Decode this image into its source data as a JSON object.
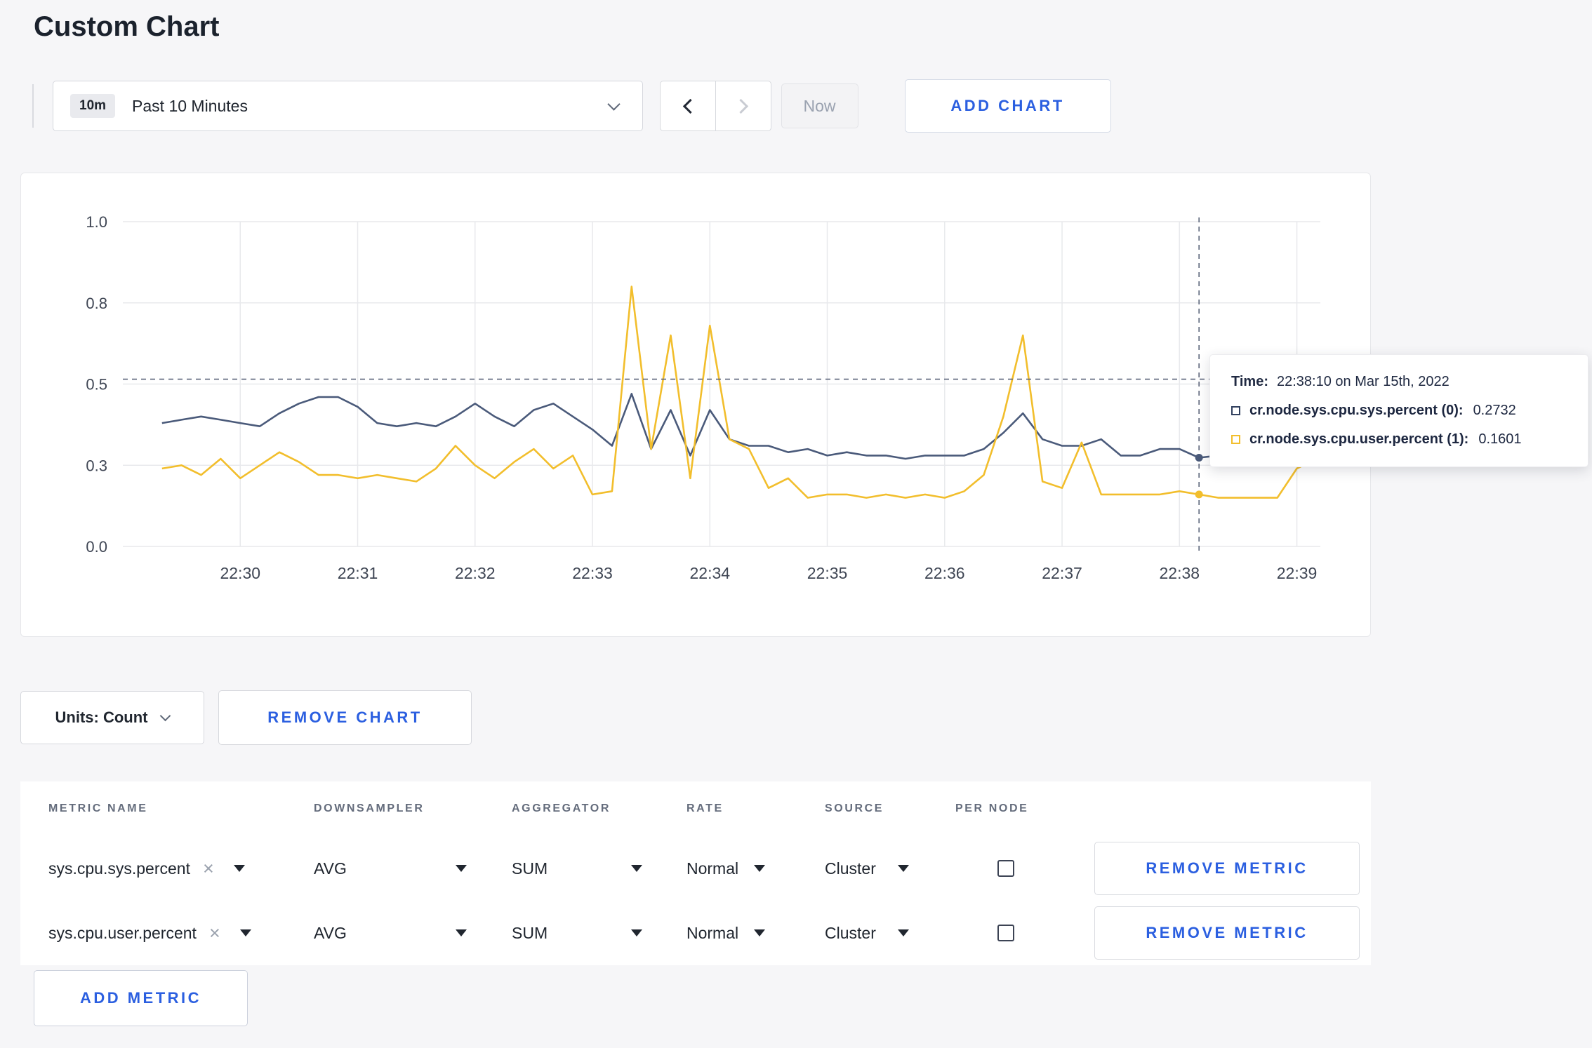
{
  "page": {
    "title": "Custom Chart"
  },
  "icons": {
    "clear": "×"
  },
  "colors": {
    "accent_blue": "#2b5fe0",
    "series_sys": "#4a5a7a",
    "series_user": "#f2be2c"
  },
  "toolbar": {
    "time_range_badge": "10m",
    "time_range_label": "Past 10 Minutes",
    "now_label": "Now",
    "add_chart_label": "ADD CHART"
  },
  "tooltip": {
    "time_label": "Time:",
    "time_value": "22:38:10 on Mar 15th, 2022",
    "rows": [
      {
        "name": "cr.node.sys.cpu.sys.percent (0):",
        "value": "0.2732",
        "color": "#32415f"
      },
      {
        "name": "cr.node.sys.cpu.user.percent (1):",
        "value": "0.1601",
        "color": "#f2be2c"
      }
    ]
  },
  "chart_data": {
    "type": "line",
    "title": "",
    "xlabel": "",
    "ylabel": "",
    "grid": true,
    "y_domain": [
      0,
      1
    ],
    "y_ticks": [
      {
        "value": 0,
        "label": "0.0"
      },
      {
        "value": 0.25,
        "label": "0.3"
      },
      {
        "value": 0.5,
        "label": "0.5"
      },
      {
        "value": 0.75,
        "label": "0.8"
      },
      {
        "value": 1,
        "label": "1.0"
      }
    ],
    "x_domain_seconds": [
      0,
      612
    ],
    "x_ticks": [
      {
        "second": 60,
        "label": "22:30"
      },
      {
        "second": 120,
        "label": "22:31"
      },
      {
        "second": 180,
        "label": "22:32"
      },
      {
        "second": 240,
        "label": "22:33"
      },
      {
        "second": 300,
        "label": "22:34"
      },
      {
        "second": 360,
        "label": "22:35"
      },
      {
        "second": 420,
        "label": "22:36"
      },
      {
        "second": 480,
        "label": "22:37"
      },
      {
        "second": 540,
        "label": "22:38"
      },
      {
        "second": 600,
        "label": "22:39"
      }
    ],
    "data_start_second": 20,
    "data_interval_seconds": 10,
    "series": [
      {
        "name": "cr.node.sys.cpu.sys.percent",
        "color": "#4a5a7a",
        "values": [
          0.38,
          0.39,
          0.4,
          0.39,
          0.38,
          0.37,
          0.41,
          0.44,
          0.46,
          0.46,
          0.43,
          0.38,
          0.37,
          0.38,
          0.37,
          0.4,
          0.44,
          0.4,
          0.37,
          0.42,
          0.44,
          0.4,
          0.36,
          0.31,
          0.47,
          0.3,
          0.42,
          0.28,
          0.42,
          0.33,
          0.31,
          0.31,
          0.29,
          0.3,
          0.28,
          0.29,
          0.28,
          0.28,
          0.27,
          0.28,
          0.28,
          0.28,
          0.3,
          0.35,
          0.41,
          0.33,
          0.31,
          0.31,
          0.33,
          0.28,
          0.28,
          0.3,
          0.3,
          0.2732,
          0.28,
          0.3,
          0.33,
          0.3,
          0.3,
          0.31
        ]
      },
      {
        "name": "cr.node.sys.cpu.user.percent",
        "color": "#f2be2c",
        "values": [
          0.24,
          0.25,
          0.22,
          0.27,
          0.21,
          0.25,
          0.29,
          0.26,
          0.22,
          0.22,
          0.21,
          0.22,
          0.21,
          0.2,
          0.24,
          0.31,
          0.25,
          0.21,
          0.26,
          0.3,
          0.24,
          0.28,
          0.16,
          0.17,
          0.8,
          0.3,
          0.65,
          0.21,
          0.68,
          0.33,
          0.3,
          0.18,
          0.21,
          0.15,
          0.16,
          0.16,
          0.15,
          0.16,
          0.15,
          0.16,
          0.15,
          0.17,
          0.22,
          0.4,
          0.65,
          0.2,
          0.18,
          0.32,
          0.16,
          0.16,
          0.16,
          0.16,
          0.17,
          0.1601,
          0.15,
          0.15,
          0.15,
          0.15,
          0.24,
          0.27
        ]
      }
    ],
    "crosshair": {
      "second": 550,
      "label": "22:38:10",
      "hline_value": 0.515,
      "points": [
        {
          "series": 0,
          "value": 0.2732
        },
        {
          "series": 1,
          "value": 0.1601
        }
      ]
    }
  },
  "chart_footer": {
    "units_label": "Units: Count",
    "remove_chart_label": "REMOVE CHART"
  },
  "metrics_table": {
    "columns": [
      "METRIC NAME",
      "DOWNSAMPLER",
      "AGGREGATOR",
      "RATE",
      "SOURCE",
      "PER NODE"
    ],
    "rows": [
      {
        "metric": "sys.cpu.sys.percent",
        "downsampler": "AVG",
        "aggregator": "SUM",
        "rate": "Normal",
        "source": "Cluster",
        "per_node_checked": false,
        "remove_label": "REMOVE METRIC"
      },
      {
        "metric": "sys.cpu.user.percent",
        "downsampler": "AVG",
        "aggregator": "SUM",
        "rate": "Normal",
        "source": "Cluster",
        "per_node_checked": false,
        "remove_label": "REMOVE METRIC"
      }
    ],
    "add_metric_label": "ADD METRIC"
  }
}
